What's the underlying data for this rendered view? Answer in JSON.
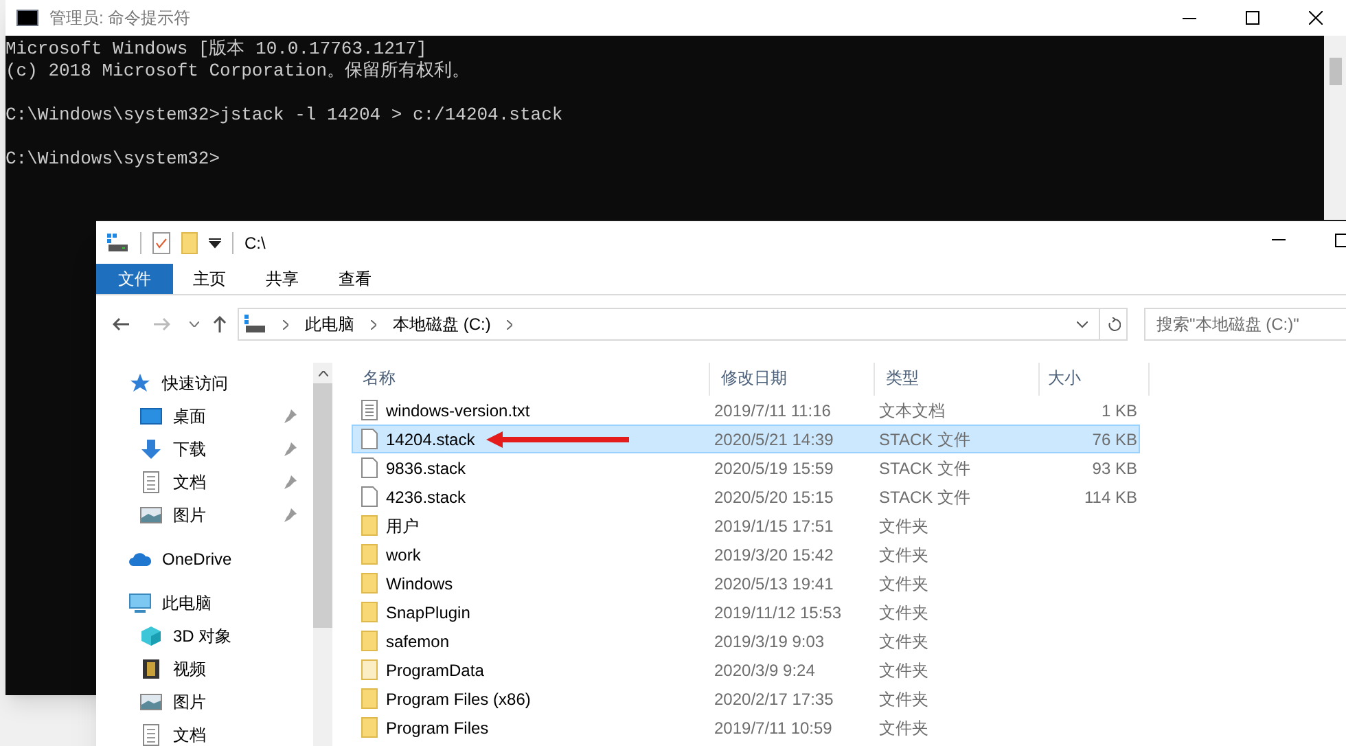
{
  "console_window": {
    "title": "管理员: 命令提示符",
    "output_groups": [
      [
        "Microsoft Windows [版本 10.0.17763.1217]",
        "(c) 2018 Microsoft Corporation。保留所有权利。"
      ],
      [
        "C:\\Windows\\system32>jstack -l 14204 > c:/14204.stack"
      ],
      [
        "C:\\Windows\\system32>"
      ]
    ]
  },
  "explorer_window": {
    "title": "C:\\",
    "ribbon_tabs": [
      {
        "label": "文件",
        "selected": true
      },
      {
        "label": "主页",
        "selected": false
      },
      {
        "label": "共享",
        "selected": false
      },
      {
        "label": "查看",
        "selected": false
      }
    ],
    "breadcrumb": [
      "此电脑",
      "本地磁盘 (C:)"
    ],
    "search": {
      "placeholder": "搜索\"本地磁盘 (C:)\""
    },
    "nav_pane": [
      {
        "label": "快速访问",
        "kind": "star",
        "pinned": false,
        "children": [
          {
            "label": "桌面",
            "kind": "desktop",
            "pinned": true
          },
          {
            "label": "下载",
            "kind": "download",
            "pinned": true
          },
          {
            "label": "文档",
            "kind": "document",
            "pinned": true
          },
          {
            "label": "图片",
            "kind": "picture",
            "pinned": true
          }
        ]
      },
      {
        "label": "OneDrive",
        "kind": "cloud",
        "pinned": false
      },
      {
        "label": "此电脑",
        "kind": "computer",
        "pinned": false,
        "children": [
          {
            "label": "3D 对象",
            "kind": "cube",
            "pinned": false
          },
          {
            "label": "视频",
            "kind": "video",
            "pinned": false
          },
          {
            "label": "图片",
            "kind": "picture",
            "pinned": false
          },
          {
            "label": "文档",
            "kind": "document",
            "pinned": false
          }
        ]
      }
    ],
    "columns": [
      "名称",
      "修改日期",
      "类型",
      "大小"
    ],
    "rows": [
      {
        "name": "windows-version.txt",
        "kind": "text",
        "date": "2019/7/11 11:16",
        "type": "文本文档",
        "size": "1 KB",
        "selected": false
      },
      {
        "name": "14204.stack",
        "kind": "file",
        "date": "2020/5/21 14:39",
        "type": "STACK 文件",
        "size": "76 KB",
        "selected": true
      },
      {
        "name": "9836.stack",
        "kind": "file",
        "date": "2020/5/19 15:59",
        "type": "STACK 文件",
        "size": "93 KB",
        "selected": false
      },
      {
        "name": "4236.stack",
        "kind": "file",
        "date": "2020/5/20 15:15",
        "type": "STACK 文件",
        "size": "114 KB",
        "selected": false
      },
      {
        "name": "用户",
        "kind": "folder",
        "date": "2019/1/15 17:51",
        "type": "文件夹",
        "selected": false
      },
      {
        "name": "work",
        "kind": "folder",
        "date": "2019/3/20 15:42",
        "type": "文件夹",
        "selected": false
      },
      {
        "name": "Windows",
        "kind": "folder",
        "date": "2020/5/13 19:41",
        "type": "文件夹",
        "selected": false
      },
      {
        "name": "SnapPlugin",
        "kind": "folder",
        "date": "2019/11/12 15:53",
        "type": "文件夹",
        "selected": false
      },
      {
        "name": "safemon",
        "kind": "folder",
        "date": "2019/3/19 9:03",
        "type": "文件夹",
        "selected": false
      },
      {
        "name": "ProgramData",
        "kind": "hidden_folder",
        "date": "2020/3/9 9:24",
        "type": "文件夹",
        "selected": false
      },
      {
        "name": "Program Files (x86)",
        "kind": "folder",
        "date": "2020/2/17 17:35",
        "type": "文件夹",
        "selected": false
      },
      {
        "name": "Program Files",
        "kind": "folder",
        "date": "2019/7/11 10:59",
        "type": "文件夹",
        "selected": false
      }
    ]
  }
}
